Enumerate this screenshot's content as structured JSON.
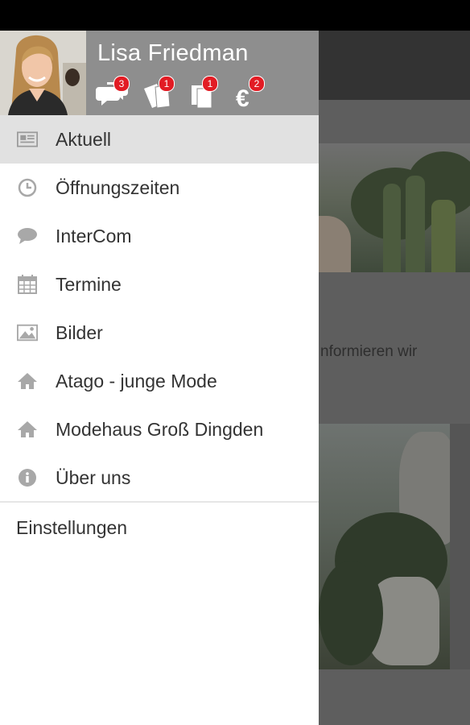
{
  "user": {
    "name": "Lisa Friedman",
    "notifications": [
      {
        "icon": "chat-bubbles-icon",
        "count": "3"
      },
      {
        "icon": "tickets-icon",
        "count": "1"
      },
      {
        "icon": "documents-icon",
        "count": "1"
      },
      {
        "icon": "euro-icon",
        "count": "2"
      }
    ]
  },
  "menu": {
    "items": [
      {
        "label": "Aktuell",
        "icon": "newspaper-icon",
        "active": true
      },
      {
        "label": "Öffnungszeiten",
        "icon": "clock-icon"
      },
      {
        "label": "InterCom",
        "icon": "chat-icon"
      },
      {
        "label": "Termine",
        "icon": "calendar-icon"
      },
      {
        "label": "Bilder",
        "icon": "image-icon"
      },
      {
        "label": "Atago - junge Mode",
        "icon": "home-icon"
      },
      {
        "label": "Modehaus Groß Dingden",
        "icon": "home-icon"
      },
      {
        "label": "Über uns",
        "icon": "info-icon"
      }
    ],
    "settings_label": "Einstellungen"
  },
  "background": {
    "text_fragment": "nformieren wir"
  },
  "colors": {
    "header_bg": "#8e8e8e",
    "badge": "#e21c24",
    "active_item": "#e1e1e1",
    "icon_gray": "#a8a8a8"
  }
}
